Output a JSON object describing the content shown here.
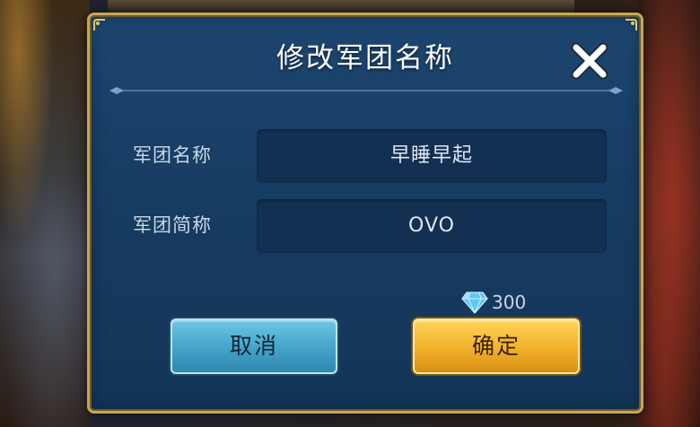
{
  "dialog": {
    "title": "修改军团名称",
    "fields": [
      {
        "label": "军团名称",
        "value": "早睡早起"
      },
      {
        "label": "军团简称",
        "value": "OVO"
      }
    ],
    "cost": {
      "icon": "diamond-icon",
      "amount": "300"
    },
    "buttons": {
      "cancel": "取消",
      "confirm": "确定"
    },
    "close_icon": "close-icon"
  },
  "colors": {
    "panel": "#173c62",
    "border_gold": "#c9a650",
    "cancel_button": "#43a3c9",
    "confirm_button": "#f2b02a"
  }
}
